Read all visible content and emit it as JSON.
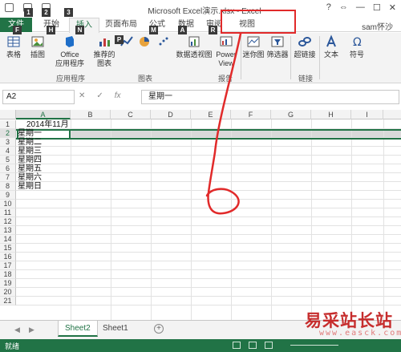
{
  "window": {
    "title": "Microsoft Excel演示.xlsx - Excel",
    "controls": [
      "?",
      "⇔",
      "—",
      "☐",
      "✕"
    ]
  },
  "keytips": [
    "1",
    "2",
    "3",
    "F",
    "H",
    "N",
    "P",
    "M",
    "A",
    "R"
  ],
  "tabs": [
    {
      "label": "文件"
    },
    {
      "label": "开始"
    },
    {
      "label": "插入"
    },
    {
      "label": "页面布局"
    },
    {
      "label": "公式"
    },
    {
      "label": "数据"
    },
    {
      "label": "审阅"
    },
    {
      "label": "视图"
    }
  ],
  "user": "sam怀沙",
  "ribbon": {
    "buttons": [
      {
        "label": "表格",
        "icon": "table-icon"
      },
      {
        "label": "插图",
        "icon": "illustration-icon"
      },
      {
        "label": "Office\n应用程序",
        "icon": "office-app-icon"
      },
      {
        "label": "推荐的\n图表",
        "icon": "recommended-chart-icon"
      },
      {
        "label": "数据透视图",
        "icon": "pivot-chart-icon"
      },
      {
        "label": "Power\nView",
        "icon": "power-view-icon"
      },
      {
        "label": "迷你图",
        "icon": "sparkline-icon"
      },
      {
        "label": "筛选器",
        "icon": "filter-icon"
      },
      {
        "label": "超链接",
        "icon": "hyperlink-icon"
      },
      {
        "label": "文本",
        "icon": "text-icon"
      },
      {
        "label": "符号",
        "icon": "symbol-icon"
      }
    ],
    "groups": [
      "应用程序",
      "图表",
      "报告",
      "链接"
    ]
  },
  "formula_bar": {
    "name_box": "A2",
    "fx": "fx",
    "content": "星期一"
  },
  "grid": {
    "columns": [
      "A",
      "B",
      "C",
      "D",
      "E",
      "F",
      "G",
      "H",
      "I"
    ],
    "rows": [
      "1",
      "2",
      "3",
      "4",
      "5",
      "6",
      "7",
      "8",
      "9",
      "10",
      "11",
      "12",
      "13",
      "14",
      "15",
      "16",
      "17",
      "18",
      "19",
      "20",
      "21"
    ],
    "cells": [
      {
        "ref": "A1",
        "value": "2014年11月"
      },
      {
        "ref": "A2",
        "value": "星期一"
      },
      {
        "ref": "A3",
        "value": "星期二"
      },
      {
        "ref": "A4",
        "value": "星期三"
      },
      {
        "ref": "A5",
        "value": "星期四"
      },
      {
        "ref": "A6",
        "value": "星期五"
      },
      {
        "ref": "A7",
        "value": "星期六"
      },
      {
        "ref": "A8",
        "value": "星期日"
      }
    ],
    "selected_row": "2",
    "selected_col": "A"
  },
  "sheets": {
    "tabs": [
      "Sheet2",
      "Sheet1"
    ],
    "active": "Sheet2",
    "add": "+"
  },
  "status": "就绪",
  "watermark": {
    "cn": "易采站长站",
    "en": "www.easck.com"
  },
  "colors": {
    "excel_green": "#217346",
    "annotation_red": "#e12a2a",
    "watermark_red": "#c62d2d"
  }
}
